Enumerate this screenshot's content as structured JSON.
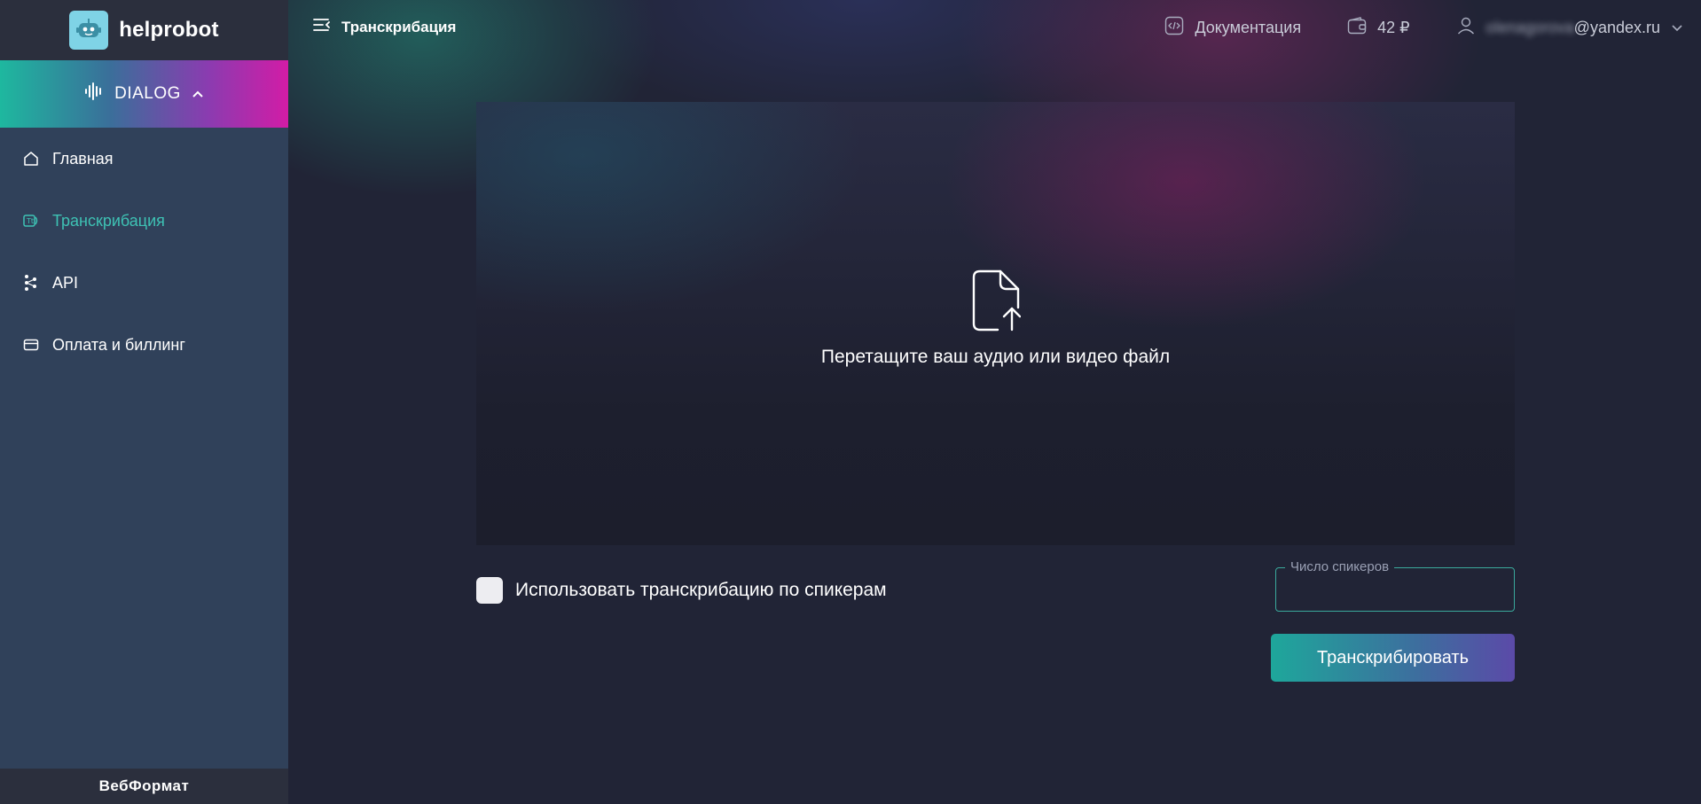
{
  "brand": {
    "name": "helprobot"
  },
  "sidebar": {
    "product_switch": {
      "label": "DIALOG"
    },
    "items": [
      {
        "label": "Главная",
        "icon": "home-icon",
        "active": false
      },
      {
        "label": "Транскрибация",
        "icon": "transcription-icon",
        "active": true
      },
      {
        "label": "API",
        "icon": "api-icon",
        "active": false
      },
      {
        "label": "Оплата и биллинг",
        "icon": "card-icon",
        "active": false
      }
    ],
    "footer": "ВебФормат"
  },
  "header": {
    "page_title": "Транскрибация",
    "docs_label": "Документация",
    "balance": "42 ₽",
    "user_email_hidden": "olenagorova",
    "user_email_domain": "@yandex.ru"
  },
  "upload": {
    "drop_text": "Перетащите ваш аудио или видео файл"
  },
  "options": {
    "speaker_checkbox_label": "Использовать транскрибацию по спикерам",
    "speaker_checkbox_checked": false,
    "speakers_field_label": "Число спикеров",
    "speakers_field_value": ""
  },
  "actions": {
    "transcribe_label": "Транскрибировать"
  },
  "colors": {
    "accent": "#3ec2b4",
    "sidebar": "#30415a",
    "background": "#212436"
  }
}
